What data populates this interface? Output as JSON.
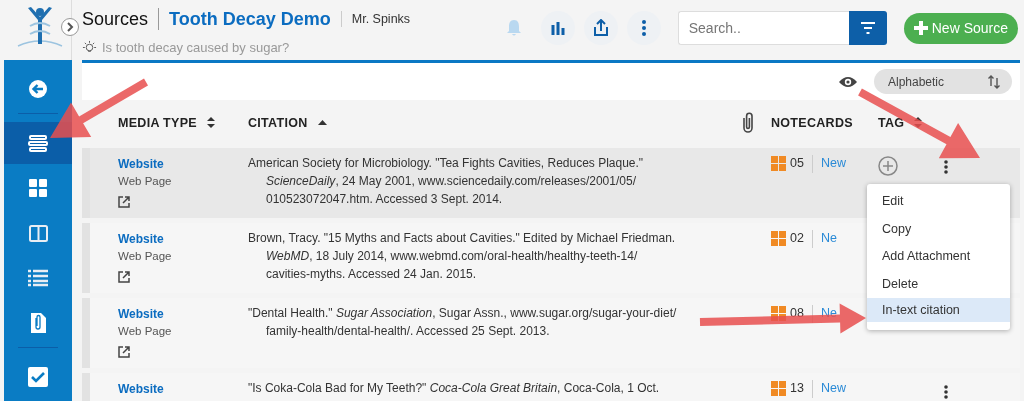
{
  "header": {
    "title": "Sources",
    "project": "Tooth Decay Demo",
    "user": "Mr. Spinks",
    "question": "Is tooth decay caused by sugar?"
  },
  "toolbar": {
    "search": {
      "placeholder": "Search.."
    },
    "new_button": "New Source"
  },
  "sidebar": {
    "sections": [
      {
        "items": [
          {
            "selected": false
          }
        ]
      },
      {
        "items": [
          {
            "selected": true
          },
          {
            "selected": false
          },
          {
            "selected": false
          },
          {
            "selected": false
          },
          {
            "selected": false
          }
        ]
      },
      {
        "items": [
          {
            "selected": false
          }
        ]
      }
    ]
  },
  "sort": {
    "label": "Alphabetic"
  },
  "table": {
    "columns": [
      {
        "kind": "text",
        "label": "MEDIA TYPE",
        "sortable": true,
        "sorted": false
      },
      {
        "kind": "text",
        "label": "CITATION",
        "sortable": true,
        "sorted": true
      },
      {
        "kind": "attachment"
      },
      {
        "kind": "text",
        "label": "NOTECARDS"
      },
      {
        "kind": "text",
        "label": "TAG",
        "sortable": true,
        "sorted": false
      }
    ],
    "rows": [
      {
        "media_type": "Website",
        "subtype": "Web Page",
        "citation_lines": [
          "American Society for Microbiology. \"Tea Fights Cavities, Reduces Plaque.\"",
          "*ScienceDaily*, 24 May 2001, www.sciencedaily.com/releases/2001/05/",
          "010523072047.htm. Accessed 3 Sept. 2014."
        ],
        "notecards": "05",
        "new_link": "New",
        "hovered": true
      },
      {
        "media_type": "Website",
        "subtype": "Web Page",
        "citation_lines": [
          "Brown, Tracy. \"15 Myths and Facts about Cavities.\" Edited by Michael Friedman.",
          "*WebMD*, 18 July 2014, www.webmd.com/oral-health/healthy-teeth-14/",
          "cavities-myths. Accessed 24 Jan. 2015."
        ],
        "notecards": "02",
        "new_link": "Ne",
        "hovered": false
      },
      {
        "media_type": "Website",
        "subtype": "Web Page",
        "citation_lines": [
          "\"Dental Health.\" *Sugar Association*, Sugar Assn., www.sugar.org/sugar-your-diet/",
          "family-health/dental-health/. Accessed 25 Sept. 2013."
        ],
        "notecards": "08",
        "new_link": "Ne",
        "hovered": false
      },
      {
        "media_type": "Website",
        "citation_lines": [
          "\"Is Coka-Cola Bad for My Teeth?\" *Coca-Cola Great Britain*, Coca-Cola, 1 Oct."
        ],
        "notecards": "13",
        "new_link": "New",
        "hovered": false
      }
    ]
  },
  "row_menu": {
    "items": [
      {
        "label": "Edit",
        "selected": false
      },
      {
        "label": "Copy",
        "selected": false
      },
      {
        "label": "Add Attachment",
        "selected": false
      },
      {
        "label": "Delete",
        "selected": false
      },
      {
        "label": "In-text citation",
        "selected": true
      }
    ]
  }
}
